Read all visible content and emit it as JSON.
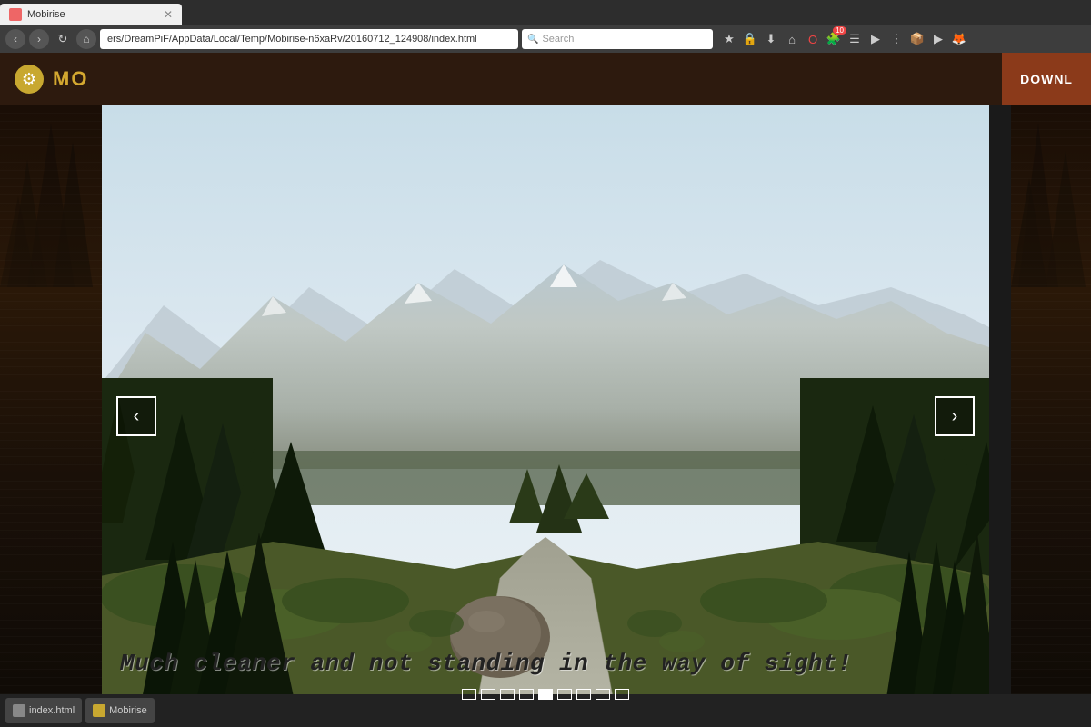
{
  "browser": {
    "address": "ers/DreamPiF/AppData/Local/Temp/Mobirise-n6xaRv/20160712_124908/index.html",
    "search_placeholder": "Search",
    "tab_label": "Mobirise",
    "badge_count": "10",
    "nav": {
      "back": "‹",
      "forward": "›",
      "refresh": "↻",
      "home": "⌂"
    }
  },
  "app": {
    "title": "MO",
    "download_label": "DOWNL",
    "gear_icon": "⚙"
  },
  "slideshow": {
    "caption": "Much cleaner and not standing in the way of sight!",
    "nav_left": "‹",
    "nav_right": "›",
    "indicators": [
      {
        "active": false
      },
      {
        "active": false
      },
      {
        "active": false
      },
      {
        "active": false
      },
      {
        "active": true
      },
      {
        "active": false
      },
      {
        "active": false
      },
      {
        "active": false
      },
      {
        "active": false
      }
    ]
  },
  "taskbar": {
    "items": [
      {
        "label": "index.html"
      },
      {
        "label": "Mobirise"
      }
    ]
  }
}
